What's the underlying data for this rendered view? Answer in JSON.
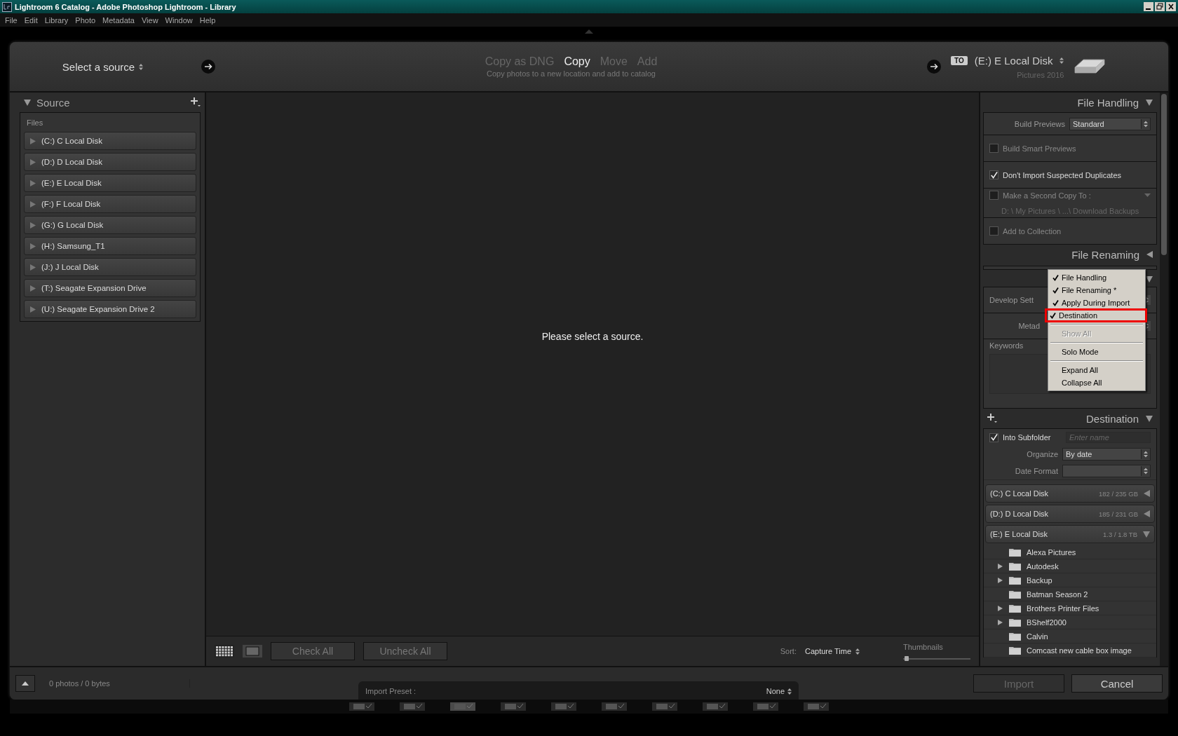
{
  "window": {
    "title": "Lightroom 6 Catalog - Adobe Photoshop Lightroom - Library"
  },
  "menu_bar": [
    "File",
    "Edit",
    "Library",
    "Photo",
    "Metadata",
    "View",
    "Window",
    "Help"
  ],
  "header": {
    "source_label": "Select a source",
    "modes": [
      {
        "label": "Copy as DNG",
        "selected": false
      },
      {
        "label": "Copy",
        "selected": true
      },
      {
        "label": "Move",
        "selected": false
      },
      {
        "label": "Add",
        "selected": false
      }
    ],
    "mode_subtitle": "Copy photos to a new location and add to catalog",
    "to_badge": "TO",
    "destination": "(E:) E Local Disk",
    "destination_sub": "Pictures 2016"
  },
  "source_panel": {
    "title": "Source",
    "expanded": true,
    "group": "Files",
    "drives": [
      "(C:) C Local Disk",
      "(D:) D Local Disk",
      "(E:) E Local Disk",
      "(F:) F Local Disk",
      "(G:) G Local Disk",
      "(H:) Samsung_T1",
      "(J:) J Local Disk",
      "(T:) Seagate Expansion Drive",
      "(U:) Seagate Expansion Drive 2"
    ]
  },
  "center": {
    "message": "Please select a source."
  },
  "toolbar": {
    "check_all": "Check All",
    "uncheck_all": "Uncheck All",
    "sort_label": "Sort:",
    "sort_value": "Capture Time",
    "thumbnails_label": "Thumbnails",
    "thumbnail_size": {
      "level": 0.05
    }
  },
  "file_handling": {
    "title": "File Handling",
    "expanded": true,
    "build_previews_label": "Build Previews",
    "build_previews_value": "Standard",
    "options": [
      {
        "label": "Build Smart Previews",
        "checked": false
      },
      {
        "label": "Don't Import Suspected Duplicates",
        "checked": true
      },
      {
        "label": "Make a Second Copy To :",
        "checked": false,
        "path": "D: \\ My Pictures \\ ...\\ Download Backups"
      },
      {
        "label": "Add to Collection",
        "checked": false
      }
    ]
  },
  "file_renaming": {
    "title": "File Renaming",
    "expanded": false
  },
  "apply_during_import": {
    "expanded": true,
    "develop_label": "Develop Sett",
    "metadata_label": "Metad",
    "keywords_label": "Keywords"
  },
  "destination": {
    "title": "Destination",
    "expanded": true,
    "into_subfolder": {
      "label": "Into Subfolder",
      "checked": true,
      "placeholder": "Enter name"
    },
    "organize": {
      "label": "Organize",
      "value": "By date"
    },
    "date_format": {
      "label": "Date Format"
    },
    "volumes": [
      {
        "name": "(C:) C Local Disk",
        "usage": "182 / 235 GB",
        "expanded": false
      },
      {
        "name": "(D:) D Local Disk",
        "usage": "185 / 231 GB",
        "expanded": false
      },
      {
        "name": "(E:) E Local Disk",
        "usage": "1.3 / 1.8 TB",
        "expanded": true
      }
    ],
    "folders": [
      {
        "name": "Alexa Pictures",
        "has_children": false
      },
      {
        "name": "Autodesk",
        "has_children": true
      },
      {
        "name": "Backup",
        "has_children": true
      },
      {
        "name": "Batman Season 2",
        "has_children": false
      },
      {
        "name": "Brothers Printer Files",
        "has_children": true
      },
      {
        "name": "BShelf2000",
        "has_children": true
      },
      {
        "name": "Calvin",
        "has_children": false
      },
      {
        "name": "Comcast new cable box image",
        "has_children": false
      }
    ]
  },
  "context_menu": {
    "items": [
      {
        "kind": "item",
        "label": "File Handling",
        "checked": true,
        "highlighted": false,
        "disabled": false
      },
      {
        "kind": "item",
        "label": "File Renaming *",
        "checked": true,
        "highlighted": false,
        "disabled": false
      },
      {
        "kind": "item",
        "label": "Apply During Import",
        "checked": true,
        "highlighted": false,
        "disabled": false
      },
      {
        "kind": "item",
        "label": "Destination",
        "checked": true,
        "highlighted": true,
        "disabled": false
      },
      {
        "kind": "separator"
      },
      {
        "kind": "item",
        "label": "Show All",
        "checked": false,
        "highlighted": false,
        "disabled": true
      },
      {
        "kind": "separator"
      },
      {
        "kind": "item",
        "label": "Solo Mode",
        "checked": false,
        "highlighted": false,
        "disabled": false
      },
      {
        "kind": "separator"
      },
      {
        "kind": "item",
        "label": "Expand All",
        "checked": false,
        "highlighted": false,
        "disabled": false
      },
      {
        "kind": "item",
        "label": "Collapse All",
        "checked": false,
        "highlighted": false,
        "disabled": false
      }
    ]
  },
  "bottom_bar": {
    "status": "0 photos / 0 bytes",
    "preset_label": "Import Preset :",
    "preset_value": "None",
    "import": {
      "label": "Import",
      "disabled": true
    },
    "cancel": {
      "label": "Cancel",
      "disabled": false
    }
  }
}
